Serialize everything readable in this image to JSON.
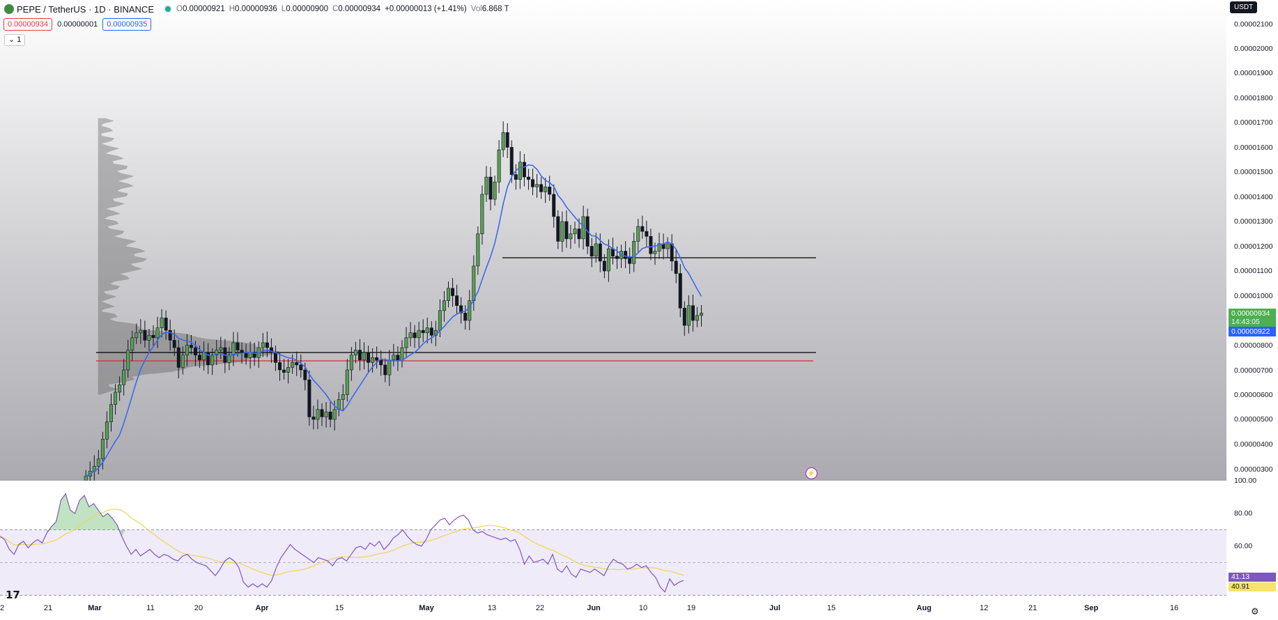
{
  "legend": {
    "title": "PEPE / TetherUS · 1D · BINANCE",
    "open_label": "O",
    "open": "0.00000921",
    "high_label": "H",
    "high": "0.00000936",
    "low_label": "L",
    "low": "0.00000900",
    "close_label": "C",
    "close": "0.00000934",
    "change": "+0.00000013 (+1.41%)",
    "vol_label": "Vol",
    "vol": "6.868 T"
  },
  "trade": {
    "sell": "0.00000934",
    "spread": "0.00000001",
    "buy": "0.00000935"
  },
  "collapse_label": "1",
  "currency": "USDT",
  "price_labels": [
    "0.00002100",
    "0.00002000",
    "0.00001900",
    "0.00001800",
    "0.00001700",
    "0.00001600",
    "0.00001500",
    "0.00001400",
    "0.00001300",
    "0.00001200",
    "0.00001100",
    "0.00001000",
    "0.00000800",
    "0.00000700",
    "0.00000600",
    "0.00000500",
    "0.00000400",
    "0.00000300"
  ],
  "last_price": "0.00000934",
  "countdown": "14:43:05",
  "ma_value": "0.00000922",
  "rsi_labels": [
    "100.00",
    "80.00",
    "60.00"
  ],
  "rsi_value": "41.13",
  "rsi_ma_value": "40.91",
  "time_labels": [
    {
      "t": "2",
      "bold": false
    },
    {
      "t": "21",
      "bold": false
    },
    {
      "t": "Mar",
      "bold": true
    },
    {
      "t": "11",
      "bold": false
    },
    {
      "t": "20",
      "bold": false
    },
    {
      "t": "Apr",
      "bold": true
    },
    {
      "t": "15",
      "bold": false
    },
    {
      "t": "May",
      "bold": true
    },
    {
      "t": "13",
      "bold": false
    },
    {
      "t": "22",
      "bold": false
    },
    {
      "t": "Jun",
      "bold": true
    },
    {
      "t": "10",
      "bold": false
    },
    {
      "t": "19",
      "bold": false
    },
    {
      "t": "Jul",
      "bold": true
    },
    {
      "t": "15",
      "bold": false
    },
    {
      "t": "Aug",
      "bold": true
    },
    {
      "t": "12",
      "bold": false
    },
    {
      "t": "21",
      "bold": false
    },
    {
      "t": "Sep",
      "bold": true
    },
    {
      "t": "16",
      "bold": false
    }
  ],
  "colors": {
    "bull": "#5a9e52",
    "bear": "#131722",
    "ma": "#3b6be8",
    "rsi": "#7e57c2",
    "rsi_ma": "#f0d660",
    "sell": "#f23645",
    "buy": "#2962ff",
    "badge_green": "#4caf50",
    "badge_blue": "#2962ff",
    "rsi_badge": "#7e57c2",
    "rsi_ma_badge": "#f7e36b"
  },
  "brand": "17",
  "icons": [
    "pepe-logo-icon",
    "market-open-dot-icon",
    "chevron-down-icon",
    "flash-icon",
    "settings-gear-icon",
    "tradingview-logo-icon"
  ]
}
